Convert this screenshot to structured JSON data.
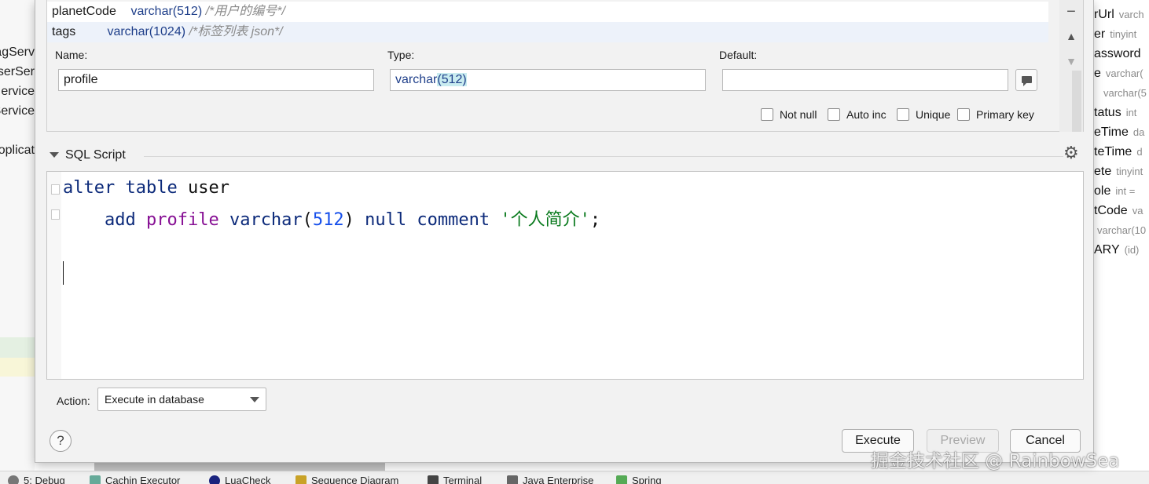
{
  "background_left": {
    "items": [
      "agServ",
      "serSer",
      "ervice",
      "Service",
      "oplicat"
    ]
  },
  "background_right": {
    "rows": [
      {
        "name": "rUrl",
        "type": "varch"
      },
      {
        "name": "er",
        "type": "tinyint"
      },
      {
        "name": "assword",
        "type": ""
      },
      {
        "name": "e",
        "type": "varchar("
      },
      {
        "name": "",
        "type": "varchar(5"
      },
      {
        "name": "tatus",
        "type": "int"
      },
      {
        "name": "eTime",
        "type": "da"
      },
      {
        "name": "teTime",
        "type": "d"
      },
      {
        "name": "ete",
        "type": "tinyint"
      },
      {
        "name": "ole",
        "type": "int ="
      },
      {
        "name": "tCode",
        "type": "va"
      },
      {
        "name": "",
        "type": "varchar(10"
      },
      {
        "name": "ARY",
        "type": "(id)"
      }
    ]
  },
  "columns": [
    {
      "name": "planetCode",
      "type": "varchar(512)",
      "comment": "/*用户的编号*/"
    },
    {
      "name": "tags",
      "type": "varchar(1024)",
      "comment": "/*标签列表 json*/"
    }
  ],
  "form": {
    "name_label": "Name:",
    "type_label": "Type:",
    "default_label": "Default:",
    "name_value": "profile",
    "type_prefix": "varchar",
    "type_paren": "(512)",
    "default_value": "",
    "not_null": "Not null",
    "auto_inc": "Auto inc",
    "unique": "Unique",
    "primary_key": "Primary key"
  },
  "side_buttons": {
    "minus": "−",
    "up": "▲",
    "down": "▼"
  },
  "sql_section": {
    "title": "SQL Script",
    "line1": {
      "kw1": "alter",
      "kw2": "table",
      "ident": "user"
    },
    "line2": {
      "kw1": "add",
      "col": "profile",
      "type": "varchar",
      "paren_open": "(",
      "num": "512",
      "paren_close": ")",
      "null": "null",
      "comment_kw": "comment",
      "str": "'个人简介'",
      "semi": ";"
    }
  },
  "action": {
    "label": "Action:",
    "selected": "Execute in database"
  },
  "buttons": {
    "help": "?",
    "execute": "Execute",
    "preview": "Preview",
    "cancel": "Cancel"
  },
  "bottom_bar": {
    "tabs": [
      "5: Debug",
      "Cachin Executor",
      "LuaCheck",
      "Sequence Diagram",
      "Terminal",
      "Java Enterprise",
      "Spring"
    ]
  },
  "watermark": "掘金技术社区 @ RainbowSea"
}
